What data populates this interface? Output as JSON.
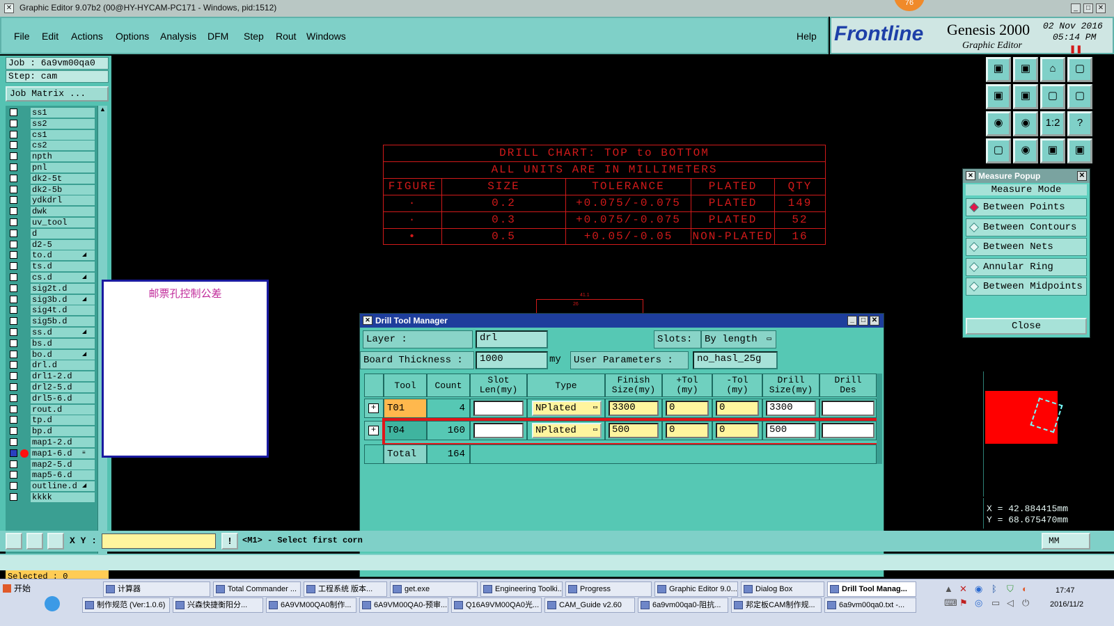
{
  "window": {
    "title": "Graphic Editor 9.07b2 (00@HY-HYCAM-PC171 - Windows, pid:1512)",
    "notify_badge": "76"
  },
  "menu": {
    "items": [
      "File",
      "Edit",
      "Actions",
      "Options",
      "Analysis",
      "DFM",
      "Step",
      "Rout",
      "Windows"
    ],
    "help": "Help"
  },
  "brand": {
    "logo_text": "Frontline",
    "product": "Genesis 2000",
    "subtitle": "Graphic Editor",
    "date": "02 Nov 2016",
    "time": "05:14 PM"
  },
  "left_panel": {
    "job": "Job :  6a9vm00qa0",
    "step": "Step:  cam",
    "job_matrix": "Job Matrix ...",
    "layers": [
      {
        "name": "ss1",
        "mark": ""
      },
      {
        "name": "ss2",
        "mark": ""
      },
      {
        "name": "cs1",
        "mark": ""
      },
      {
        "name": "cs2",
        "mark": ""
      },
      {
        "name": "npth",
        "mark": ""
      },
      {
        "name": "pnl",
        "mark": ""
      },
      {
        "name": "dk2-5t",
        "mark": ""
      },
      {
        "name": "dk2-5b",
        "mark": ""
      },
      {
        "name": "ydkdrl",
        "mark": ""
      },
      {
        "name": "dwk",
        "mark": ""
      },
      {
        "name": "uv_tool",
        "mark": ""
      },
      {
        "name": "d",
        "mark": ""
      },
      {
        "name": "d2-5",
        "mark": ""
      },
      {
        "name": "to.d",
        "mark": "◢"
      },
      {
        "name": "ts.d",
        "mark": ""
      },
      {
        "name": "cs.d",
        "mark": "◢"
      },
      {
        "name": "sig2t.d",
        "mark": ""
      },
      {
        "name": "sig3b.d",
        "mark": "◢"
      },
      {
        "name": "sig4t.d",
        "mark": ""
      },
      {
        "name": "sig5b.d",
        "mark": ""
      },
      {
        "name": "ss.d",
        "mark": "◢"
      },
      {
        "name": "bs.d",
        "mark": ""
      },
      {
        "name": "bo.d",
        "mark": "◢"
      },
      {
        "name": "drl.d",
        "mark": ""
      },
      {
        "name": "drl1-2.d",
        "mark": ""
      },
      {
        "name": "drl2-5.d",
        "mark": ""
      },
      {
        "name": "drl5-6.d",
        "mark": ""
      },
      {
        "name": "rout.d",
        "mark": ""
      },
      {
        "name": "tp.d",
        "mark": ""
      },
      {
        "name": "bp.d",
        "mark": ""
      },
      {
        "name": "map1-2.d",
        "mark": ""
      },
      {
        "name": "map1-6.d",
        "mark": "≡"
      },
      {
        "name": "map2-5.d",
        "mark": ""
      },
      {
        "name": "map5-6.d",
        "mark": ""
      },
      {
        "name": "outline.d",
        "mark": "◢"
      },
      {
        "name": "kkkk",
        "mark": ""
      }
    ],
    "selected": "Selected :  0"
  },
  "drill_chart": {
    "title": "DRILL CHART: TOP to BOTTOM",
    "units": "ALL UNITS ARE IN MILLIMETERS",
    "headers": [
      "FIGURE",
      "SIZE",
      "TOLERANCE",
      "PLATED",
      "QTY"
    ],
    "rows": [
      [
        "·",
        "0.2",
        "+0.075/-0.075",
        "PLATED",
        "149"
      ],
      [
        "·",
        "0.3",
        "+0.075/-0.075",
        "PLATED",
        "52"
      ],
      [
        "•",
        "0.5",
        "+0.05/-0.05",
        "NON-PLATED",
        "16"
      ]
    ]
  },
  "note_panel": {
    "text": "邮票孔控制公差"
  },
  "small_dims": {
    "top": "41.1",
    "mid": "26"
  },
  "dtm": {
    "title": "Drill Tool Manager",
    "layer_label": "Layer           :",
    "layer_value": "drl",
    "slots_label": "Slots:",
    "slots_value": "By length",
    "thickness_label": "Board Thickness :",
    "thickness_value": "1000",
    "thickness_unit": "my",
    "user_params_label": "User Parameters :",
    "user_params_value": "no_hasl_25g",
    "columns": [
      {
        "l1": "Tool",
        "l2": ""
      },
      {
        "l1": "Count",
        "l2": ""
      },
      {
        "l1": "Slot",
        "l2": "Len(my)"
      },
      {
        "l1": "Type",
        "l2": ""
      },
      {
        "l1": "Finish",
        "l2": "Size(my)"
      },
      {
        "l1": "+Tol",
        "l2": "(my)"
      },
      {
        "l1": "-Tol",
        "l2": "(my)"
      },
      {
        "l1": "Drill",
        "l2": "Size(my)"
      },
      {
        "l1": "Drill",
        "l2": "Des"
      }
    ],
    "rows": [
      {
        "tool": "T01",
        "count": "4",
        "slot_len": "",
        "type": "NPlated",
        "finish": "3300",
        "plus_tol": "0",
        "minus_tol": "0",
        "drill_size": "3300",
        "drill_des": ""
      },
      {
        "tool": "T04",
        "count": "160",
        "slot_len": "",
        "type": "NPlated",
        "finish": "500",
        "plus_tol": "0",
        "minus_tol": "0",
        "drill_size": "500",
        "drill_des": ""
      }
    ],
    "total_label": "Total",
    "total_count": "164"
  },
  "measure": {
    "title": "Measure Popup",
    "mode_label": "Measure Mode",
    "options": [
      "Between Points",
      "Between Contours",
      "Between Nets",
      "Annular Ring",
      "Between Midpoints"
    ],
    "selected_index": 0,
    "close": "Close"
  },
  "right_toolbar": {
    "buttons": [
      "▣",
      "▣",
      "⌂",
      "▢",
      "▣",
      "▣",
      "▢",
      "▢",
      "◉",
      "◉",
      "1:2",
      "?",
      "▢",
      "◉",
      "▣",
      "▣"
    ]
  },
  "coords": {
    "x": "X  =  42.884415mm",
    "y": "Y  =  68.675470mm"
  },
  "cmd": {
    "xy_label": "X Y :",
    "prompt": "<M1> - Select first corn",
    "units": "MM"
  },
  "taskbar": {
    "start": "开始",
    "row1": [
      "计算器",
      "Total Commander ...",
      "工程系统 版本...",
      "get.exe",
      "Engineering Toolki...",
      "Progress",
      "Graphic Editor 9.0...",
      "Dialog Box",
      "Drill Tool Manag..."
    ],
    "row2": [
      "制作规范 (Ver:1.0.6)",
      "兴森快捷衡阳分...",
      "6A9VM00QA0制作...",
      "6A9VM00QA0-预审...",
      "Q16A9VM00QA0光...",
      "CAM_Guide v2.60",
      "6a9vm00qa0-阻抗...",
      "邦定板CAM制作规...",
      "6a9vm00qa0.txt -..."
    ],
    "clock_time": "17:47",
    "clock_date": "2016/11/2"
  },
  "colors": {
    "teal": "#56c8b4",
    "menu": "#7fd0c8",
    "chart_red": "#d21a1a",
    "highlight_red": "#e0161a",
    "title_blue": "#1e3e9c",
    "tool_orange": "#ffb84d"
  }
}
